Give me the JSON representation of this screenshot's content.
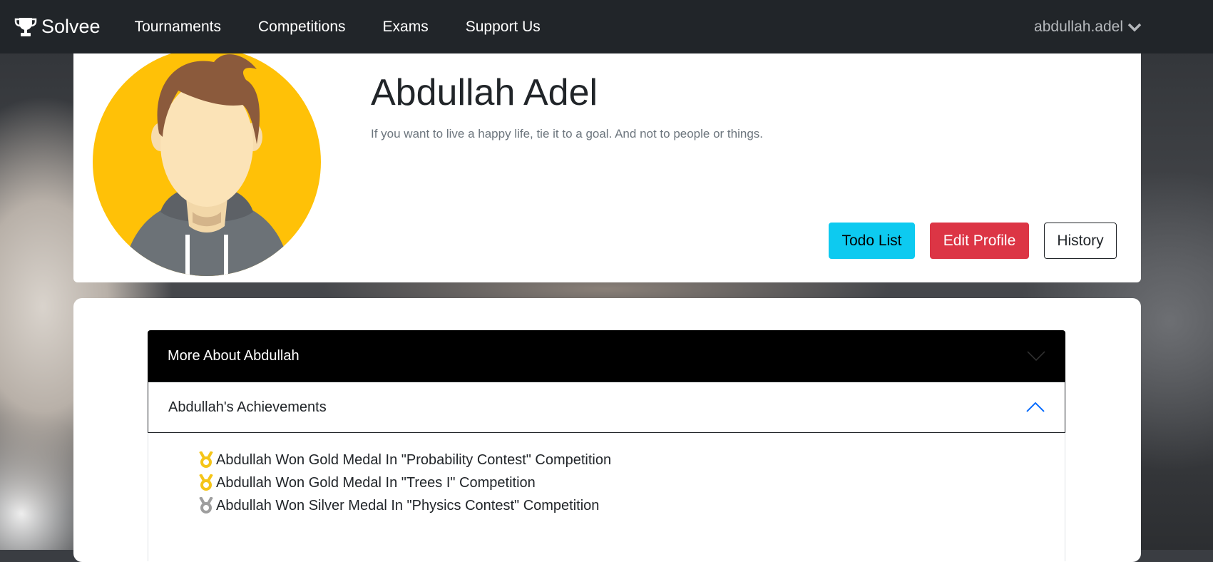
{
  "navbar": {
    "brand": "Solvee",
    "links": [
      "Tournaments",
      "Competitions",
      "Exams",
      "Support Us"
    ],
    "user": "abdullah.adel"
  },
  "profile": {
    "name": "Abdullah Adel",
    "quote": "If you want to live a happy life, tie it to a goal. And not to people or things.",
    "buttons": {
      "todo": "Todo List",
      "edit": "Edit Profile",
      "history": "History"
    }
  },
  "accordion": {
    "more_about": "More About Abdullah",
    "achievements_title": "Abdullah's Achievements",
    "achievements": [
      {
        "text": "Abdullah Won Gold Medal In \"Probability Contest\" Competition",
        "medal": "gold"
      },
      {
        "text": "Abdullah Won Gold Medal In \"Trees I\" Competition",
        "medal": "gold"
      },
      {
        "text": "Abdullah Won Silver Medal In \"Physics Contest\" Competition",
        "medal": "silver"
      }
    ]
  },
  "colors": {
    "navbar": "#212529",
    "todo_button": "#0dcaf0",
    "edit_button": "#dc3545",
    "gold_medal": "#f5c518",
    "silver_medal": "#9e9e9e",
    "avatar_bg": "#ffc107"
  }
}
